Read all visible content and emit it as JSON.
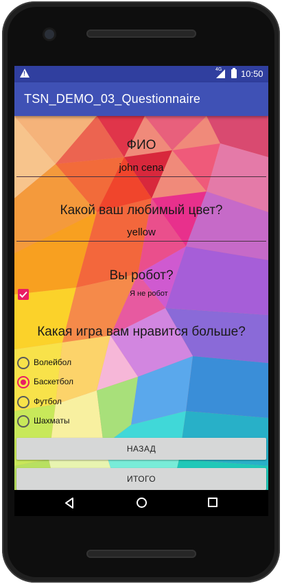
{
  "status_bar": {
    "time": "10:50",
    "network": "4G"
  },
  "app_bar": {
    "title": "TSN_DEMO_03_Questionnaire"
  },
  "form": {
    "name": {
      "label": "ФИО",
      "value": "john cena"
    },
    "color": {
      "label": "Какой ваш любимый цвет?",
      "value": "yellow"
    },
    "robot": {
      "label": "Вы робот?",
      "checkbox_label": "Я не робот",
      "checked": true
    },
    "game": {
      "label": "Какая игра вам нравится больше?",
      "options": [
        {
          "label": "Волейбол",
          "selected": false
        },
        {
          "label": "Баскетбол",
          "selected": true
        },
        {
          "label": "Футбол",
          "selected": false
        },
        {
          "label": "Шахматы",
          "selected": false
        }
      ]
    }
  },
  "buttons": {
    "back": "НАЗАД",
    "total": "ИТОГО"
  },
  "colors": {
    "status_bar": "#303F9F",
    "app_bar": "#3F51B5",
    "accent": "#E91E63",
    "button": "#D6D7D7"
  }
}
